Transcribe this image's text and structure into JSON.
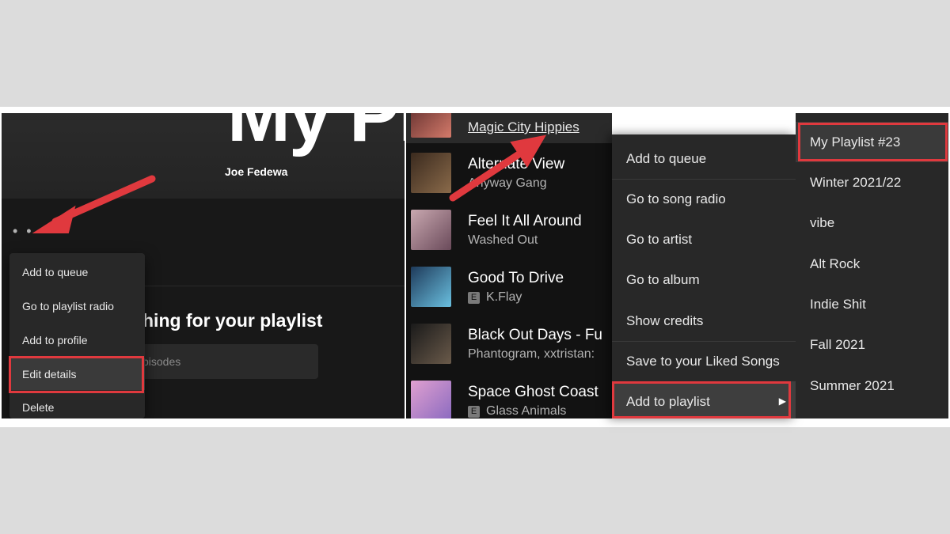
{
  "left_pane": {
    "playlist_title": "My Pl",
    "owner": "Joe Fedewa",
    "more_dots": "• • •",
    "search_heading": "hing for your playlist",
    "search_placeholder": "pisodes",
    "context_menu": [
      "Add to queue",
      "Go to playlist radio",
      "Add to profile",
      "Edit details",
      "Delete"
    ]
  },
  "middle_pane": {
    "tracks": [
      {
        "title": "Magic City Hippies",
        "artist": "",
        "explicit": false,
        "art_colors": [
          "#5a2a2a",
          "#d47a6a"
        ]
      },
      {
        "title": "Alternate View",
        "artist": "Anyway Gang",
        "explicit": false,
        "art_colors": [
          "#3a2a1e",
          "#8a6a4a"
        ]
      },
      {
        "title": "Feel It All Around",
        "artist": "Washed Out",
        "explicit": false,
        "art_colors": [
          "#c9a8b0",
          "#6a4a5a"
        ]
      },
      {
        "title": "Good To Drive",
        "artist": "K.Flay",
        "explicit": true,
        "art_colors": [
          "#1e3a5a",
          "#6ac0e0"
        ]
      },
      {
        "title": "Black Out Days - Fu",
        "artist": "Phantogram, xxtristan:",
        "explicit": false,
        "art_colors": [
          "#1a1a1a",
          "#6a5a4a"
        ]
      },
      {
        "title": "Space Ghost Coast",
        "artist": "Glass Animals",
        "explicit": true,
        "art_colors": [
          "#e0a0d0",
          "#8a6ac0"
        ]
      }
    ],
    "explicit_badge": "E"
  },
  "track_context_menu": [
    "Add to queue",
    "Go to song radio",
    "Go to artist",
    "Go to album",
    "Show credits",
    "Save to your Liked Songs",
    "Add to playlist"
  ],
  "submenu_arrow": "▶",
  "playlist_submenu": [
    "My Playlist #23",
    "Winter 2021/22",
    "vibe",
    "Alt Rock",
    "Indie Shit",
    "Fall 2021",
    "Summer 2021"
  ],
  "colors": {
    "highlight": "#e0393e",
    "menu_bg": "#282828",
    "app_bg": "#121212"
  }
}
